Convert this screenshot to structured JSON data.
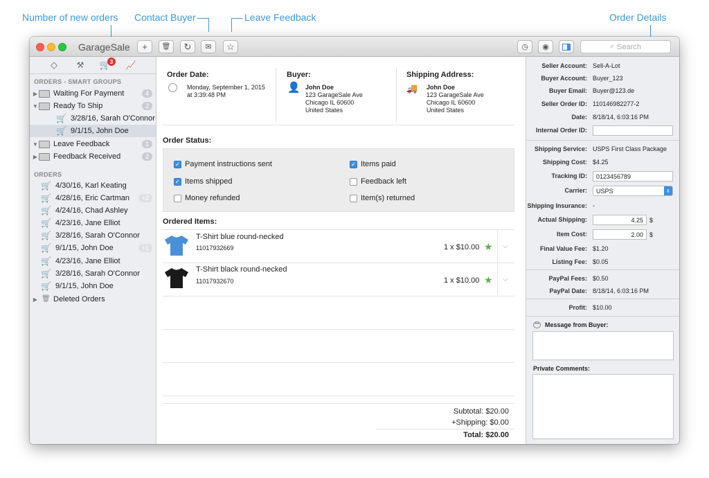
{
  "callouts": {
    "new_orders": "Number of new orders",
    "contact_buyer": "Contact Buyer",
    "leave_feedback": "Leave Feedback",
    "order_details": "Order Details"
  },
  "app": {
    "title": "GarageSale",
    "search_placeholder": "Search"
  },
  "toolbar": {
    "add": "+",
    "trash": "🗑",
    "refresh": "↻",
    "mail": "✉",
    "star": "☆"
  },
  "sidebar": {
    "badge": "3",
    "smart_groups_header": "ORDERS - SMART GROUPS",
    "smart_groups": [
      {
        "label": "Waiting For Payment",
        "count": "4"
      },
      {
        "label": "Ready To Ship",
        "count": "2"
      },
      {
        "label": "3/28/16, Sarah O'Connor",
        "count": ""
      },
      {
        "label": "9/1/15, John Doe",
        "count": ""
      },
      {
        "label": "Leave Feedback",
        "count": "1"
      },
      {
        "label": "Feedback Received",
        "count": "2"
      }
    ],
    "orders_header": "ORDERS",
    "orders": [
      {
        "label": "4/30/16, Karl Keating",
        "count": ""
      },
      {
        "label": "4/28/16, Eric Cartman",
        "count": "+2"
      },
      {
        "label": "4/24/16, Chad Ashley",
        "count": ""
      },
      {
        "label": "4/23/16, Jane Elliot",
        "count": ""
      },
      {
        "label": "3/28/16, Sarah O'Connor",
        "count": ""
      },
      {
        "label": "9/1/15, John Doe",
        "count": "+1"
      },
      {
        "label": "4/23/16, Jane Elliot",
        "count": ""
      },
      {
        "label": "3/28/16, Sarah O'Connor",
        "count": ""
      },
      {
        "label": "9/1/15, John Doe",
        "count": ""
      },
      {
        "label": "Deleted Orders",
        "count": ""
      }
    ]
  },
  "order": {
    "date_label": "Order Date:",
    "date_line1": "Monday, September 1, 2015",
    "date_line2": "at 3:39:48 PM",
    "buyer_label": "Buyer:",
    "buyer_name": "John Doe",
    "buyer_addr1": "123 GarageSale Ave",
    "buyer_addr2": "Chicago IL 60600",
    "buyer_addr3": "United States",
    "ship_label": "Shipping Address:",
    "ship_name": "John Doe",
    "ship_addr1": "123 GarageSale Ave",
    "ship_addr2": "Chicago IL 60600",
    "ship_addr3": "United States",
    "status_label": "Order Status:",
    "status": [
      {
        "label": "Payment instructions sent",
        "checked": true
      },
      {
        "label": "Items shipped",
        "checked": true
      },
      {
        "label": "Money refunded",
        "checked": false
      },
      {
        "label": "Items paid",
        "checked": true
      },
      {
        "label": "Feedback left",
        "checked": false
      },
      {
        "label": "Item(s) returned",
        "checked": false
      }
    ],
    "items_label": "Ordered Items:",
    "items": [
      {
        "title": "T-Shirt blue round-necked",
        "sku": "11017932669",
        "price": "1 x $10.00",
        "color": "#4a90d9"
      },
      {
        "title": "T-Shirt black round-necked",
        "sku": "11017932670",
        "price": "1 x $10.00",
        "color": "#1a1a1a"
      }
    ],
    "subtotal": "Subtotal: $20.00",
    "shipping": "+Shipping: $0.00",
    "total": "Total: $20.00"
  },
  "details": {
    "seller_account_label": "Seller Account:",
    "seller_account": "Sell-A-Lot",
    "buyer_account_label": "Buyer Account:",
    "buyer_account": "Buyer_123",
    "buyer_email_label": "Buyer Email:",
    "buyer_email": "Buyer@123.de",
    "seller_order_label": "Seller Order ID:",
    "seller_order": "110146982277-2",
    "date_label": "Date:",
    "date": "8/18/14, 6:03:16 PM",
    "internal_label": "Internal Order ID:",
    "internal": "",
    "service_label": "Shipping Service:",
    "service": "USPS First Class Package",
    "cost_label": "Shipping Cost:",
    "cost": "$4.25",
    "tracking_label": "Tracking ID:",
    "tracking": "0123456789",
    "carrier_label": "Carrier:",
    "carrier": "USPS",
    "insurance_label": "Shipping Insurance:",
    "insurance": "-",
    "actual_label": "Actual Shipping:",
    "actual": "4.25",
    "actual_unit": "$",
    "itemcost_label": "Item Cost:",
    "itemcost": "2.00",
    "itemcost_unit": "$",
    "fvf_label": "Final Value Fee:",
    "fvf": "$1.20",
    "listing_label": "Listing Fee:",
    "listing": "$0.05",
    "pp_fees_label": "PayPal Fees:",
    "pp_fees": "$0.50",
    "pp_date_label": "PayPal Date:",
    "pp_date": "8/18/14, 6:03:16 PM",
    "profit_label": "Profit:",
    "profit": "$10.00",
    "message_label": "Message from Buyer:",
    "comments_label": "Private Comments:"
  }
}
